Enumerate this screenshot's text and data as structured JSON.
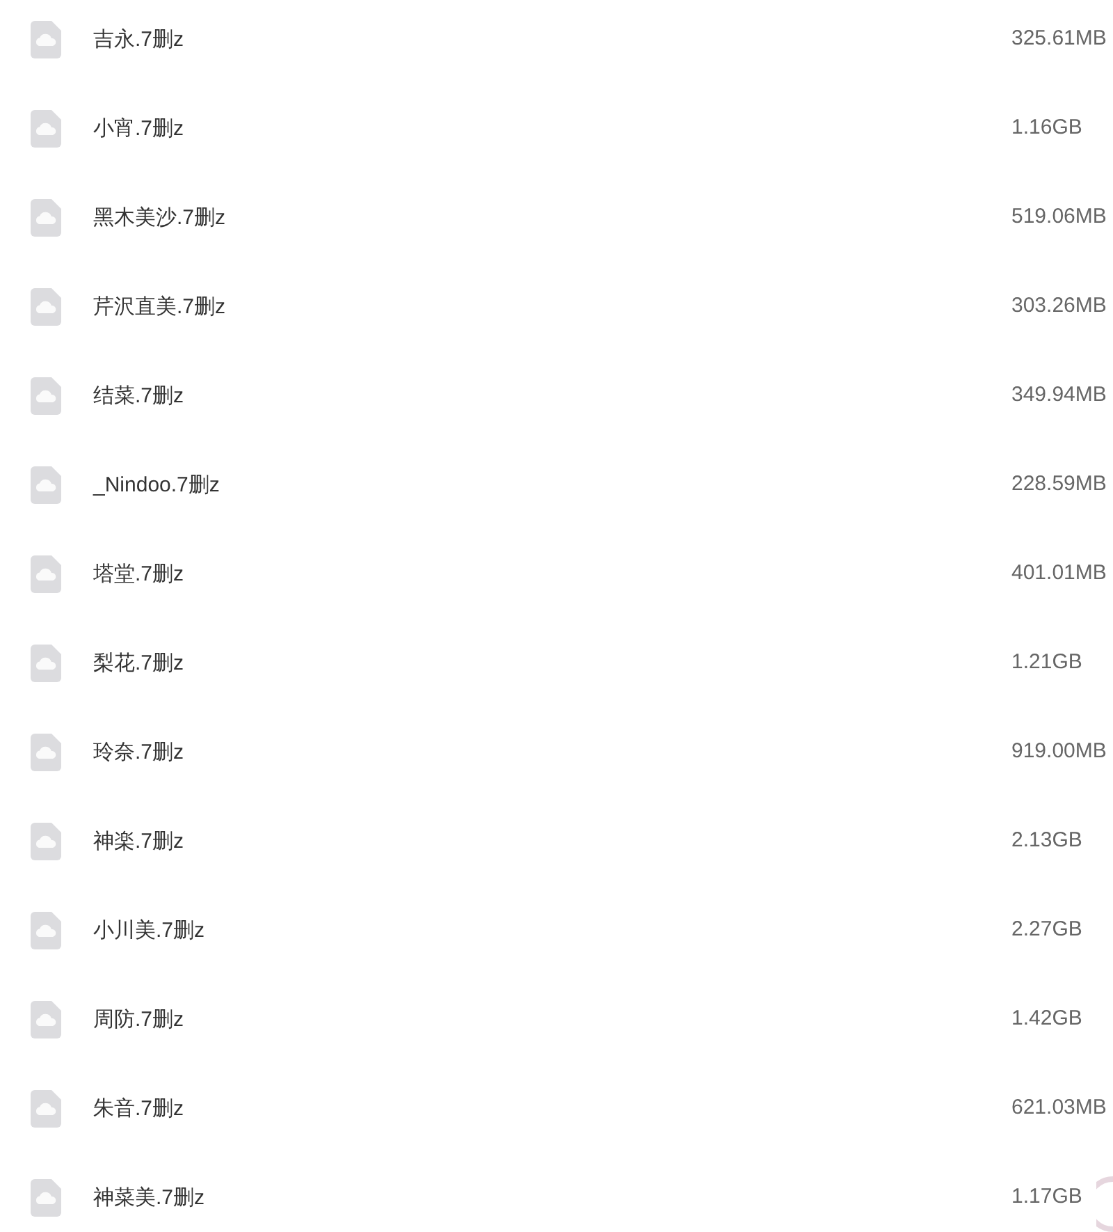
{
  "files": [
    {
      "name": "吉永.7删z",
      "size": "325.61MB"
    },
    {
      "name": "小宵.7删z",
      "size": "1.16GB"
    },
    {
      "name": "黑木美沙.7删z",
      "size": "519.06MB"
    },
    {
      "name": "芹沢直美.7删z",
      "size": "303.26MB"
    },
    {
      "name": "结菜.7删z",
      "size": "349.94MB"
    },
    {
      "name": "_Nindoo.7删z",
      "size": "228.59MB"
    },
    {
      "name": "塔堂.7删z",
      "size": "401.01MB"
    },
    {
      "name": "梨花.7删z",
      "size": "1.21GB"
    },
    {
      "name": "玲奈.7删z",
      "size": "919.00MB"
    },
    {
      "name": "神楽.7删z",
      "size": "2.13GB"
    },
    {
      "name": "小川美.7删z",
      "size": "2.27GB"
    },
    {
      "name": "周防.7删z",
      "size": "1.42GB"
    },
    {
      "name": "朱音.7删z",
      "size": "621.03MB"
    },
    {
      "name": "神菜美.7删z",
      "size": "1.17GB"
    }
  ]
}
